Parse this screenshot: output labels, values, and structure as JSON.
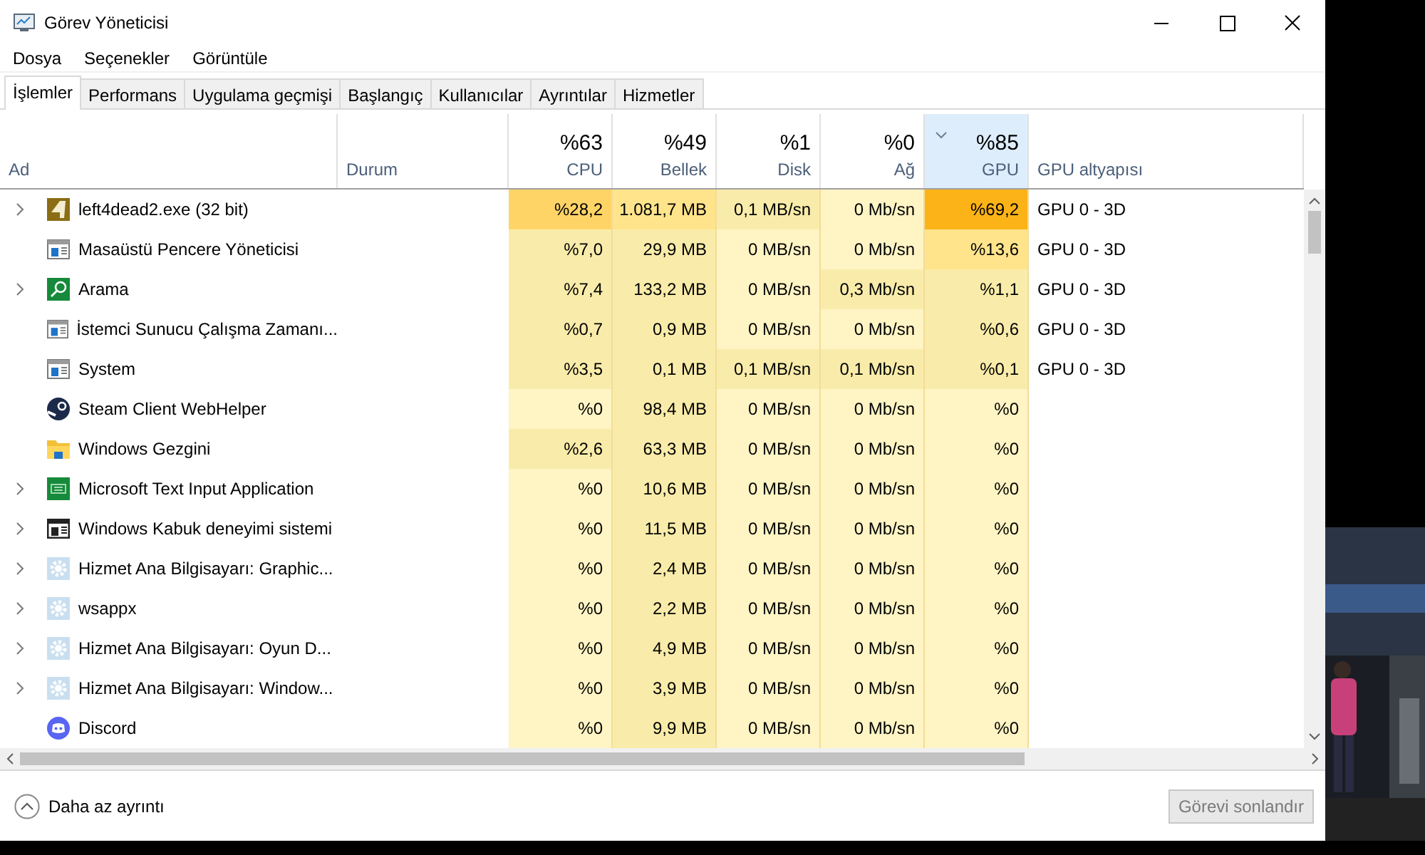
{
  "window": {
    "title": "Görev Yöneticisi"
  },
  "menu": [
    "Dosya",
    "Seçenekler",
    "Görüntüle"
  ],
  "tabs": [
    {
      "label": "İşlemler",
      "selected": true
    },
    {
      "label": "Performans",
      "selected": false
    },
    {
      "label": "Uygulama geçmişi",
      "selected": false
    },
    {
      "label": "Başlangıç",
      "selected": false
    },
    {
      "label": "Kullanıcılar",
      "selected": false
    },
    {
      "label": "Ayrıntılar",
      "selected": false
    },
    {
      "label": "Hizmetler",
      "selected": false
    }
  ],
  "table": {
    "columns": [
      {
        "label": "Ad",
        "sorted": false
      },
      {
        "label": "Durum",
        "sorted": false
      },
      {
        "label": "CPU",
        "total": "%63",
        "sorted": false
      },
      {
        "label": "Bellek",
        "total": "%49",
        "sorted": false
      },
      {
        "label": "Disk",
        "total": "%1",
        "sorted": false
      },
      {
        "label": "Ağ",
        "total": "%0",
        "sorted": false
      },
      {
        "label": "GPU",
        "total": "%85",
        "sorted": true
      },
      {
        "label": "GPU altyapısı",
        "sorted": false
      }
    ],
    "rows": [
      {
        "name": "left4dead2.exe (32 bit)",
        "kind": "game",
        "expandable": true,
        "metrics": [
          {
            "text": "%28,2",
            "color": "#ffd467"
          },
          {
            "text": "1.081,7 MB",
            "color": "#ffe48c"
          },
          {
            "text": "0,1 MB/sn",
            "color": "#f9ecaa"
          },
          {
            "text": "0 Mb/sn",
            "color": "#fff4c4"
          },
          {
            "text": "%69,2",
            "color": "#fcb317"
          }
        ],
        "gpu_engine": "GPU 0 - 3D"
      },
      {
        "name": "Masaüstü Pencere Yöneticisi",
        "kind": "window",
        "expandable": false,
        "metrics": [
          {
            "text": "%7,0",
            "color": "#f9ecaa"
          },
          {
            "text": "29,9 MB",
            "color": "#f9ecaa"
          },
          {
            "text": "0 MB/sn",
            "color": "#fff4c4"
          },
          {
            "text": "0 Mb/sn",
            "color": "#fff4c4"
          },
          {
            "text": "%13,6",
            "color": "#ffe48c"
          }
        ],
        "gpu_engine": "GPU 0 - 3D"
      },
      {
        "name": "Arama",
        "kind": "search",
        "expandable": true,
        "metrics": [
          {
            "text": "%7,4",
            "color": "#f9ecaa"
          },
          {
            "text": "133,2 MB",
            "color": "#f9ecaa"
          },
          {
            "text": "0 MB/sn",
            "color": "#fff4c4"
          },
          {
            "text": "0,3 Mb/sn",
            "color": "#f9ecaa"
          },
          {
            "text": "%1,1",
            "color": "#f9ecaa"
          }
        ],
        "gpu_engine": "GPU 0 - 3D"
      },
      {
        "name": "İstemci Sunucu Çalışma Zamanı...",
        "kind": "window",
        "expandable": false,
        "metrics": [
          {
            "text": "%0,7",
            "color": "#f9ecaa"
          },
          {
            "text": "0,9 MB",
            "color": "#f9ecaa"
          },
          {
            "text": "0 MB/sn",
            "color": "#fff4c4"
          },
          {
            "text": "0 Mb/sn",
            "color": "#fff4c4"
          },
          {
            "text": "%0,6",
            "color": "#f9ecaa"
          }
        ],
        "gpu_engine": "GPU 0 - 3D"
      },
      {
        "name": "System",
        "kind": "window",
        "expandable": false,
        "metrics": [
          {
            "text": "%3,5",
            "color": "#f9ecaa"
          },
          {
            "text": "0,1 MB",
            "color": "#f9ecaa"
          },
          {
            "text": "0,1 MB/sn",
            "color": "#f9ecaa"
          },
          {
            "text": "0,1 Mb/sn",
            "color": "#f9ecaa"
          },
          {
            "text": "%0,1",
            "color": "#f9ecaa"
          }
        ],
        "gpu_engine": "GPU 0 - 3D"
      },
      {
        "name": "Steam Client WebHelper",
        "kind": "steam",
        "expandable": false,
        "metrics": [
          {
            "text": "%0",
            "color": "#fff4c4"
          },
          {
            "text": "98,4 MB",
            "color": "#f9ecaa"
          },
          {
            "text": "0 MB/sn",
            "color": "#fff4c4"
          },
          {
            "text": "0 Mb/sn",
            "color": "#fff4c4"
          },
          {
            "text": "%0",
            "color": "#fff4c4"
          }
        ]
      },
      {
        "name": "Windows Gezgini",
        "kind": "folder",
        "expandable": false,
        "metrics": [
          {
            "text": "%2,6",
            "color": "#f9ecaa"
          },
          {
            "text": "63,3 MB",
            "color": "#f9ecaa"
          },
          {
            "text": "0 MB/sn",
            "color": "#fff4c4"
          },
          {
            "text": "0 Mb/sn",
            "color": "#fff4c4"
          },
          {
            "text": "%0",
            "color": "#fff4c4"
          }
        ]
      },
      {
        "name": "Microsoft Text Input Application",
        "kind": "keyboard",
        "expandable": true,
        "metrics": [
          {
            "text": "%0",
            "color": "#fff4c4"
          },
          {
            "text": "10,6 MB",
            "color": "#f9ecaa"
          },
          {
            "text": "0 MB/sn",
            "color": "#fff4c4"
          },
          {
            "text": "0 Mb/sn",
            "color": "#fff4c4"
          },
          {
            "text": "%0",
            "color": "#fff4c4"
          }
        ]
      },
      {
        "name": "Windows Kabuk deneyimi sistemi",
        "kind": "shell",
        "expandable": true,
        "metrics": [
          {
            "text": "%0",
            "color": "#fff4c4"
          },
          {
            "text": "11,5 MB",
            "color": "#f9ecaa"
          },
          {
            "text": "0 MB/sn",
            "color": "#fff4c4"
          },
          {
            "text": "0 Mb/sn",
            "color": "#fff4c4"
          },
          {
            "text": "%0",
            "color": "#fff4c4"
          }
        ]
      },
      {
        "name": "Hizmet Ana Bilgisayarı: Graphic...",
        "kind": "gear",
        "expandable": true,
        "metrics": [
          {
            "text": "%0",
            "color": "#fff4c4"
          },
          {
            "text": "2,4 MB",
            "color": "#f9ecaa"
          },
          {
            "text": "0 MB/sn",
            "color": "#fff4c4"
          },
          {
            "text": "0 Mb/sn",
            "color": "#fff4c4"
          },
          {
            "text": "%0",
            "color": "#fff4c4"
          }
        ]
      },
      {
        "name": "wsappx",
        "kind": "gear",
        "expandable": true,
        "metrics": [
          {
            "text": "%0",
            "color": "#fff4c4"
          },
          {
            "text": "2,2 MB",
            "color": "#f9ecaa"
          },
          {
            "text": "0 MB/sn",
            "color": "#fff4c4"
          },
          {
            "text": "0 Mb/sn",
            "color": "#fff4c4"
          },
          {
            "text": "%0",
            "color": "#fff4c4"
          }
        ]
      },
      {
        "name": "Hizmet Ana Bilgisayarı: Oyun D...",
        "kind": "gear",
        "expandable": true,
        "metrics": [
          {
            "text": "%0",
            "color": "#fff4c4"
          },
          {
            "text": "4,9 MB",
            "color": "#f9ecaa"
          },
          {
            "text": "0 MB/sn",
            "color": "#fff4c4"
          },
          {
            "text": "0 Mb/sn",
            "color": "#fff4c4"
          },
          {
            "text": "%0",
            "color": "#fff4c4"
          }
        ]
      },
      {
        "name": "Hizmet Ana Bilgisayarı: Window...",
        "kind": "gear",
        "expandable": true,
        "metrics": [
          {
            "text": "%0",
            "color": "#fff4c4"
          },
          {
            "text": "3,9 MB",
            "color": "#f9ecaa"
          },
          {
            "text": "0 MB/sn",
            "color": "#fff4c4"
          },
          {
            "text": "0 Mb/sn",
            "color": "#fff4c4"
          },
          {
            "text": "%0",
            "color": "#fff4c4"
          }
        ]
      },
      {
        "name": "Discord",
        "kind": "discord",
        "expandable": false,
        "metrics": [
          {
            "text": "%0",
            "color": "#fff4c4"
          },
          {
            "text": "9,9 MB",
            "color": "#f9ecaa"
          },
          {
            "text": "0 MB/sn",
            "color": "#fff4c4"
          },
          {
            "text": "0 Mb/sn",
            "color": "#fff4c4"
          },
          {
            "text": "%0",
            "color": "#fff4c4"
          }
        ]
      }
    ]
  },
  "footer": {
    "details_toggle": "Daha az ayrıntı",
    "end_task": {
      "label": "Görevi sonlandır",
      "disabled": true
    }
  }
}
